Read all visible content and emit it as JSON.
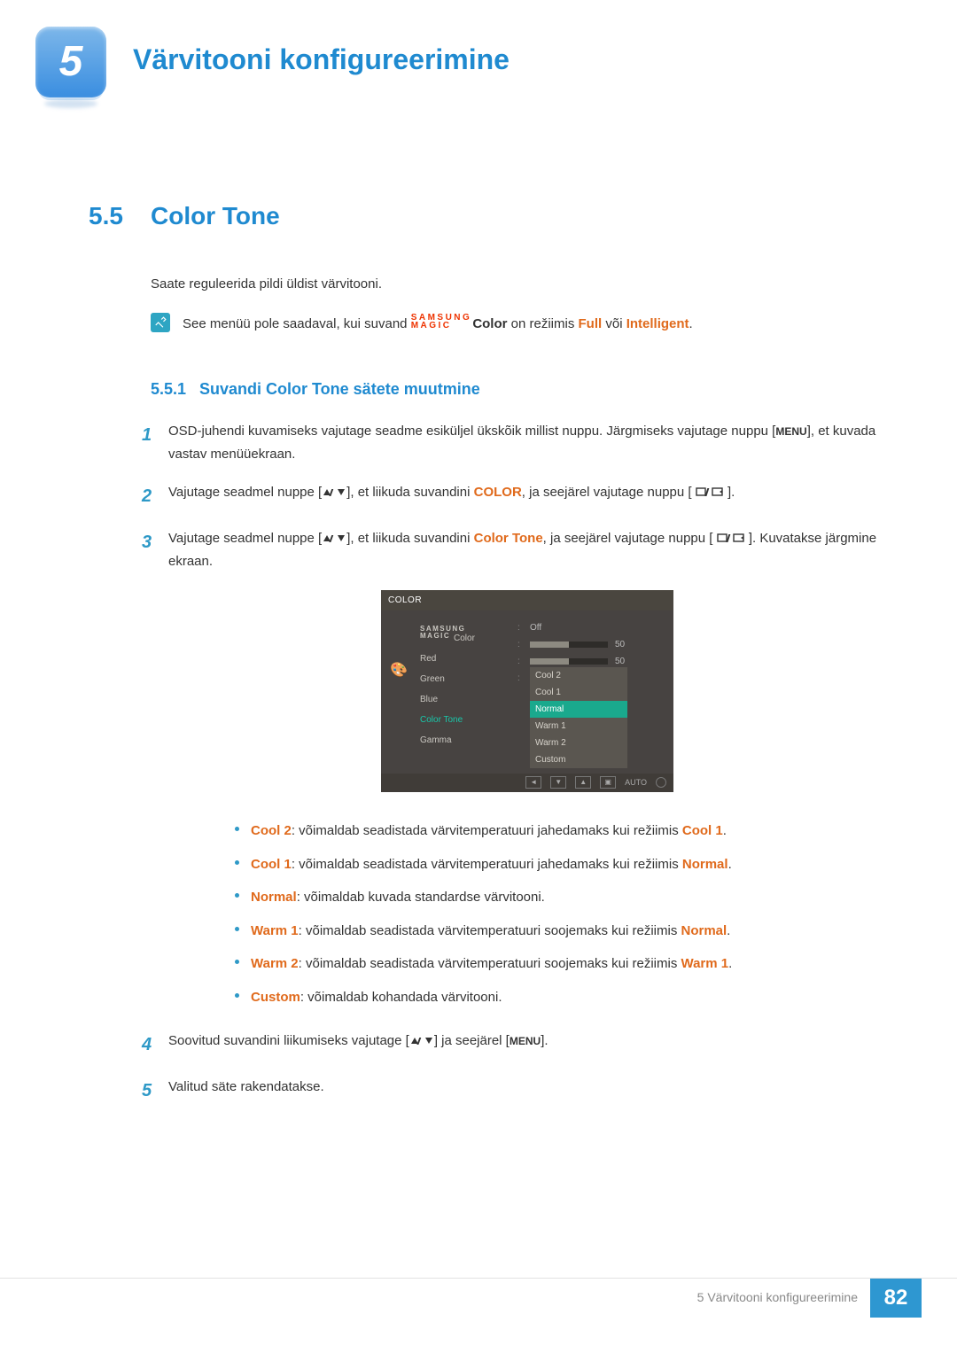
{
  "chapter": {
    "number": "5",
    "title": "Värvitooni konfigureerimine"
  },
  "section": {
    "number": "5.5",
    "title": "Color Tone"
  },
  "intro": "Saate reguleerida pildi üldist värvitooni.",
  "note": {
    "pre": "See menüü pole saadaval, kui suvand ",
    "logo_top": "SAMSUNG",
    "logo_bot": "MAGIC",
    "prod": "Color",
    "mid": " on režiimis ",
    "m1": "Full",
    "or": " või ",
    "m2": "Intelligent",
    "end": "."
  },
  "subsection": {
    "number": "5.5.1",
    "title": "Suvandi Color Tone sätete muutmine"
  },
  "steps": {
    "s1a": "OSD-juhendi kuvamiseks vajutage seadme esiküljel ükskõik millist nuppu. Järgmiseks vajutage nuppu [",
    "s1menu": "MENU",
    "s1b": "], et kuvada vastav menüüekraan.",
    "s2a": "Vajutage seadmel nuppe [",
    "s2b": "], et liikuda suvandini ",
    "s2col": "COLOR",
    "s2c": ", ja seejärel vajutage nuppu [",
    "s2d": "].",
    "s3a": "Vajutage seadmel nuppe [",
    "s3b": "], et liikuda suvandini ",
    "s3ct": "Color Tone",
    "s3c": ", ja seejärel vajutage nuppu [",
    "s3d": "]. Kuvatakse järgmine ekraan.",
    "s4a": "Soovitud suvandini liikumiseks vajutage [",
    "s4b": "] ja seejärel [",
    "s4menu": "MENU",
    "s4c": "].",
    "s5": "Valitud säte rakendatakse."
  },
  "osd": {
    "title": "COLOR",
    "items": [
      "Red",
      "Green",
      "Blue",
      "Color Tone",
      "Gamma"
    ],
    "magic_top": "SAMSUNG",
    "magic_bot": "MAGIC",
    "magic_lbl": " Color",
    "off": "Off",
    "v_red": "50",
    "v_green": "50",
    "options": [
      "Cool 2",
      "Cool 1",
      "Normal",
      "Warm 1",
      "Warm 2",
      "Custom"
    ],
    "selected": "Normal",
    "auto": "AUTO"
  },
  "bullets": [
    {
      "k": "Cool 2",
      "t": ": võimaldab seadistada värvitemperatuuri jahedamaks kui režiimis ",
      "r": "Cool 1",
      "e": "."
    },
    {
      "k": "Cool 1",
      "t": ": võimaldab seadistada värvitemperatuuri jahedamaks kui režiimis ",
      "r": "Normal",
      "e": "."
    },
    {
      "k": "Normal",
      "t": ": võimaldab kuvada standardse värvitooni.",
      "r": "",
      "e": ""
    },
    {
      "k": "Warm 1",
      "t": ": võimaldab seadistada värvitemperatuuri soojemaks kui režiimis ",
      "r": "Normal",
      "e": "."
    },
    {
      "k": "Warm 2",
      "t": ": võimaldab seadistada värvitemperatuuri soojemaks kui režiimis ",
      "r": "Warm 1",
      "e": "."
    },
    {
      "k": "Custom",
      "t": ": võimaldab kohandada värvitooni.",
      "r": "",
      "e": ""
    }
  ],
  "footer": {
    "text": "5 Värvitooni konfigureerimine",
    "page": "82"
  }
}
